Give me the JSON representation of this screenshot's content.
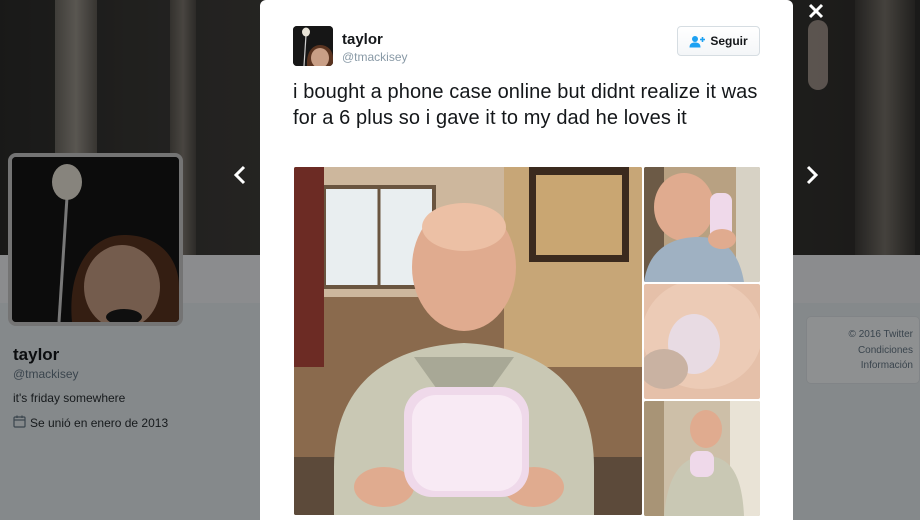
{
  "background_profile": {
    "name": "taylor",
    "handle": "@tmackisey",
    "bio": "it's friday somewhere",
    "joined": "Se unió en enero de 2013",
    "icons": {
      "calendar": "calendar-icon"
    }
  },
  "footer": {
    "copyright": "© 2016 Twitter",
    "conditions": "Condiciones",
    "info": "Información"
  },
  "modal": {
    "author": {
      "name": "taylor",
      "handle": "@tmackisey"
    },
    "follow_button": {
      "label": "Seguir",
      "icon": "add-user-icon"
    },
    "tweet_text": "i bought a phone case online but didnt realize it was for a 6 plus so i gave it to my dad he loves it",
    "photos": [
      "main-photo",
      "photo-2",
      "photo-3",
      "photo-4"
    ]
  },
  "controls": {
    "close_icon": "close-icon",
    "prev_icon": "chevron-left-icon",
    "next_icon": "chevron-right-icon"
  },
  "colors": {
    "overlay": "#000000",
    "page_bg": "#e6ecf0",
    "text_primary": "#14171a",
    "text_secondary": "#8899a6"
  }
}
